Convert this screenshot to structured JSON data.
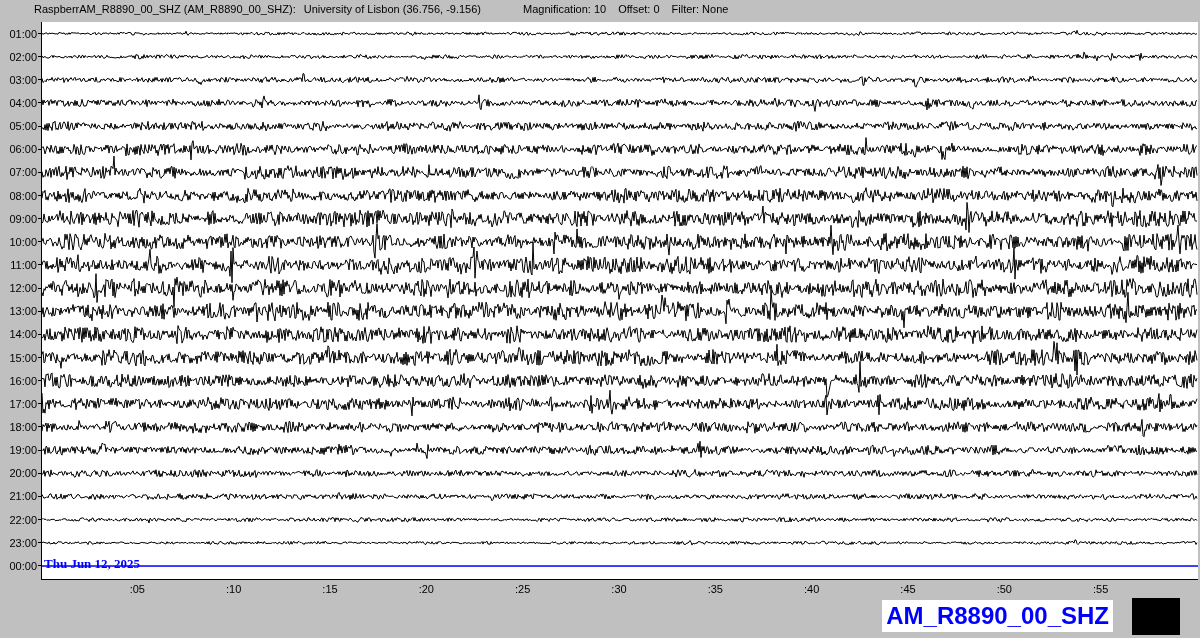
{
  "header": {
    "station": "RaspberrAM_R8890_00_SHZ (AM_R8890_00_SHZ):",
    "location": "University of Lisbon (36.756, -9.156)",
    "magnification": "Magnification: 10",
    "offset": "Offset: 0",
    "filter": "Filter: None"
  },
  "rows": [
    {
      "label": "01:00",
      "current": false
    },
    {
      "label": "02:00",
      "current": false
    },
    {
      "label": "03:00",
      "current": false
    },
    {
      "label": "04:00",
      "current": false
    },
    {
      "label": "05:00",
      "current": false
    },
    {
      "label": "06:00",
      "current": false
    },
    {
      "label": "07:00",
      "current": false
    },
    {
      "label": "08:00",
      "current": false
    },
    {
      "label": "09:00",
      "current": false
    },
    {
      "label": "10:00",
      "current": false
    },
    {
      "label": "11:00",
      "current": false
    },
    {
      "label": "12:00",
      "current": false
    },
    {
      "label": "13:00",
      "current": false
    },
    {
      "label": "14:00",
      "current": false
    },
    {
      "label": "15:00",
      "current": false
    },
    {
      "label": "16:00",
      "current": false
    },
    {
      "label": "17:00",
      "current": false
    },
    {
      "label": "18:00",
      "current": false
    },
    {
      "label": "19:00",
      "current": false
    },
    {
      "label": "20:00",
      "current": false
    },
    {
      "label": "21:00",
      "current": false
    },
    {
      "label": "22:00",
      "current": false
    },
    {
      "label": "23:00",
      "current": false
    },
    {
      "label": "00:00",
      "current": true
    }
  ],
  "date": "Thu Jun 12, 2025",
  "minute_ticks": [
    ":05",
    ":10",
    ":15",
    ":20",
    ":25",
    ":30",
    ":35",
    ":40",
    ":45",
    ":50",
    ":55"
  ],
  "station_label": "AM_R8890_00_SHZ"
}
